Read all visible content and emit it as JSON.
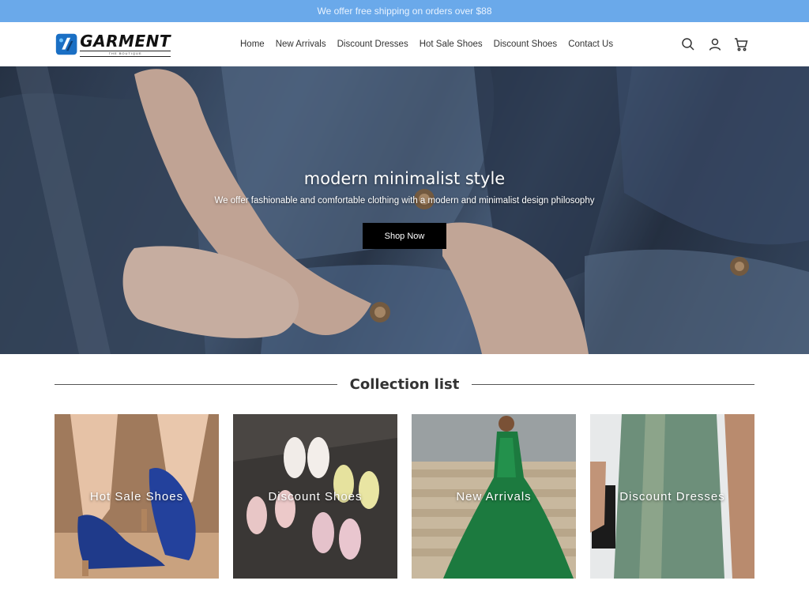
{
  "announcement": "We offer free shipping on orders over $88",
  "brand": {
    "name": "GARMENT",
    "tagline": "THE BOUTIQUE"
  },
  "nav": [
    {
      "label": "Home"
    },
    {
      "label": "New Arrivals"
    },
    {
      "label": "Discount Dresses"
    },
    {
      "label": "Hot Sale Shoes"
    },
    {
      "label": "Discount Shoes"
    },
    {
      "label": "Contact Us"
    }
  ],
  "header_icons": [
    "search-icon",
    "account-icon",
    "cart-icon"
  ],
  "hero": {
    "title": "modern minimalist style",
    "subtitle": "We offer fashionable and comfortable clothing with a modern and minimalist design philosophy",
    "button": "Shop Now"
  },
  "collection": {
    "title": "Collection list",
    "items": [
      {
        "label": "Hot Sale Shoes"
      },
      {
        "label": "Discount Shoes"
      },
      {
        "label": "New Arrivals"
      },
      {
        "label": "Discount Dresses"
      }
    ]
  },
  "colors": {
    "announcement_bg": "#6aa9ea",
    "button_bg": "#000000",
    "text": "#333333"
  }
}
